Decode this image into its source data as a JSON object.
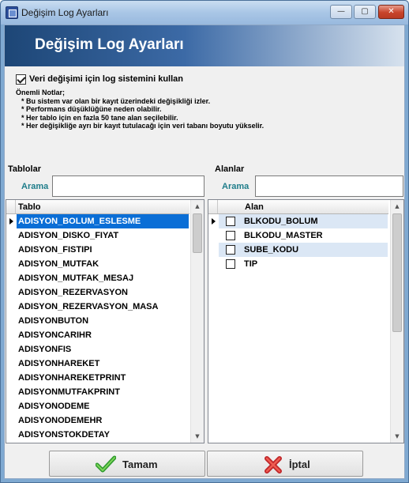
{
  "window": {
    "title": "Değişim Log Ayarları"
  },
  "window_controls": {
    "minimize": "—",
    "maximize": "▢",
    "close": "✕"
  },
  "banner": {
    "title": "Değişim Log Ayarları"
  },
  "log_option": {
    "label": "Veri değişimi için log sistemini kullan",
    "checked": true
  },
  "notes": {
    "title": "Önemli Notlar;",
    "items": [
      "* Bu sistem var olan bir kayıt üzerindeki değişikliği izler.",
      "* Performans düşüklüğüne neden olabilir.",
      "* Her tablo için en fazla 50 tane alan seçilebilir.",
      "* Her değişikliğe ayrı bir kayıt tutulacağı için veri tabanı boyutu yükselir."
    ]
  },
  "tables_panel": {
    "label": "Tablolar",
    "search_label": "Arama",
    "search_value": "",
    "column": "Tablo",
    "current_row": 0,
    "rows": [
      "ADISYON_BOLUM_ESLESME",
      "ADISYON_DISKO_FIYAT",
      "ADISYON_FISTIPI",
      "ADISYON_MUTFAK",
      "ADISYON_MUTFAK_MESAJ",
      "ADISYON_REZERVASYON",
      "ADISYON_REZERVASYON_MASA",
      "ADISYONBUTON",
      "ADISYONCARIHR",
      "ADISYONFIS",
      "ADISYONHAREKET",
      "ADISYONHAREKETPRINT",
      "ADISYONMUTFAKPRINT",
      "ADISYONODEME",
      "ADISYONODEMEHR",
      "ADISYONSTOKDETAY"
    ]
  },
  "fields_panel": {
    "label": "Alanlar",
    "search_label": "Arama",
    "search_value": "",
    "column": "Alan",
    "rows": [
      {
        "name": "BLKODU_BOLUM",
        "checked": false
      },
      {
        "name": "BLKODU_MASTER",
        "checked": false
      },
      {
        "name": "SUBE_KODU",
        "checked": false
      },
      {
        "name": "TIP",
        "checked": false
      }
    ]
  },
  "buttons": {
    "ok": "Tamam",
    "cancel": "İptal"
  },
  "colors": {
    "accent": "#0a6ed6",
    "search_label": "#1f7d8a",
    "banner_dark": "#1d4676"
  },
  "icons": {
    "ok": "green-check-icon",
    "cancel": "red-x-icon",
    "app": "app-icon"
  }
}
